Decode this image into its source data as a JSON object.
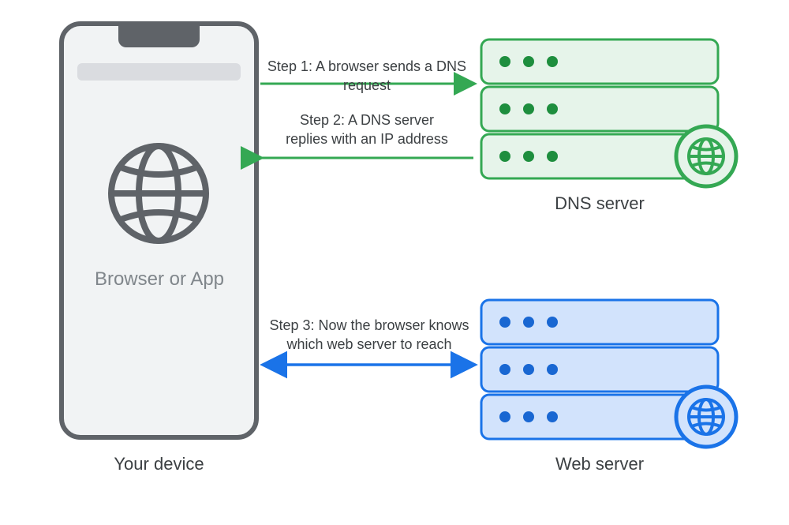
{
  "device": {
    "label": "Your device",
    "browser_caption": "Browser or App"
  },
  "dns": {
    "label": "DNS server"
  },
  "web": {
    "label": "Web server"
  },
  "steps": {
    "s1": "Step 1: A browser sends a DNS request",
    "s2": "Step 2: A DNS server\nreplies with an IP address",
    "s3": "Step 3: Now the browser knows\nwhich web server to reach"
  },
  "colors": {
    "device_stroke": "#5f6368",
    "device_fill": "#f1f3f4",
    "device_bar": "#dadce0",
    "green_stroke": "#34a853",
    "green_fill": "#e6f4ea",
    "green_dot": "#1e8e3e",
    "blue_stroke": "#1a73e8",
    "blue_fill": "#d2e3fc",
    "blue_dot": "#1967d2"
  }
}
